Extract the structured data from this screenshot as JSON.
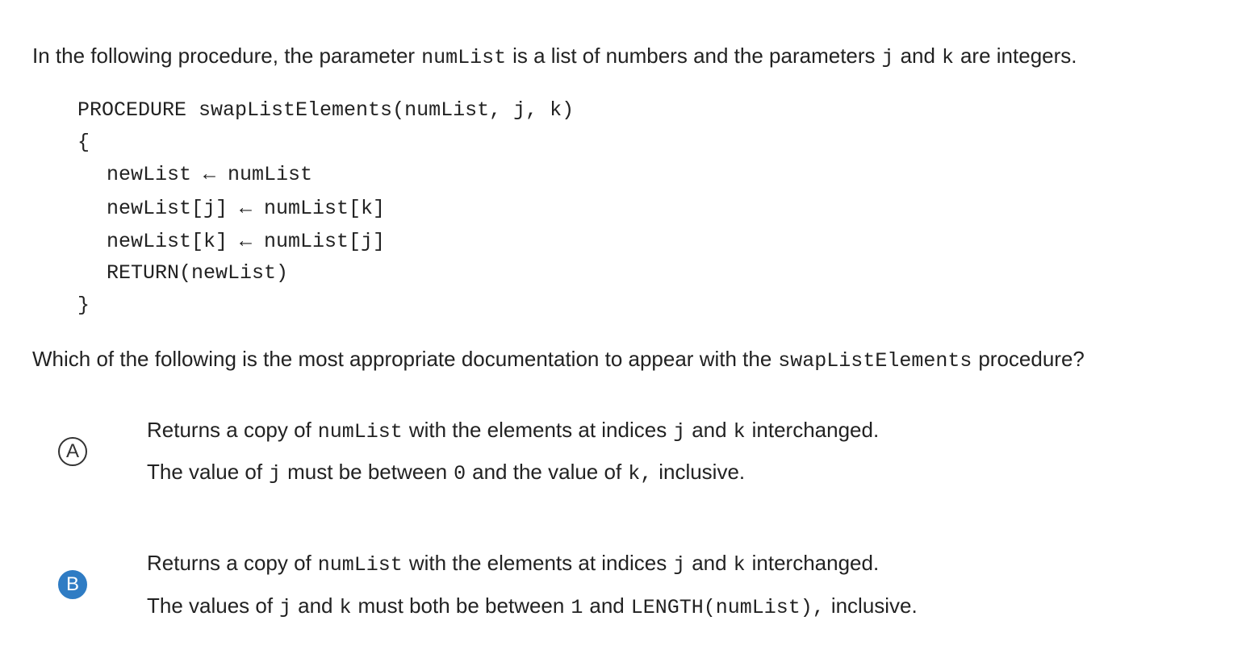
{
  "prompt": {
    "t1": "In the following procedure, the parameter",
    "c1": "numList",
    "t2": "is a list of numbers and the parameters",
    "c2": "j",
    "t3": "and",
    "c3": "k",
    "t4": "are integers."
  },
  "code": {
    "lines": [
      "PROCEDURE swapListElements(numList, j, k)",
      "{",
      "newList ← numList",
      "newList[j] ← numList[k]",
      "newList[k] ← numList[j]",
      "RETURN(newList)",
      "}"
    ]
  },
  "question": {
    "t1": "Which of the following is the most appropriate documentation to appear with the",
    "c1": "swapListElements",
    "t2": "procedure?"
  },
  "choices": [
    {
      "letter": "A",
      "selected": false,
      "line1": {
        "t1": "Returns a copy of",
        "c1": "numList",
        "t2": "with the elements at indices",
        "c2": "j",
        "t3": "and",
        "c3": "k",
        "t4": "interchanged."
      },
      "line2": {
        "t1": "The value of",
        "c1": "j",
        "t2": "must be between",
        "c2": "0",
        "t3": "and the value of",
        "c3": "k,",
        "t4": "inclusive."
      }
    },
    {
      "letter": "B",
      "selected": true,
      "line1": {
        "t1": "Returns a copy of",
        "c1": "numList",
        "t2": "with the elements at indices",
        "c2": "j",
        "t3": "and",
        "c3": "k",
        "t4": "interchanged."
      },
      "line2": {
        "t1": "The values of",
        "c1": "j",
        "t2": "and",
        "c2": "k",
        "t3": "must both be between",
        "c3": "1",
        "t4": "and",
        "c4": "LENGTH(numList),",
        "t5": "inclusive."
      }
    }
  ],
  "colors": {
    "selected_badge": "#2f7cc4",
    "text": "#222222"
  }
}
